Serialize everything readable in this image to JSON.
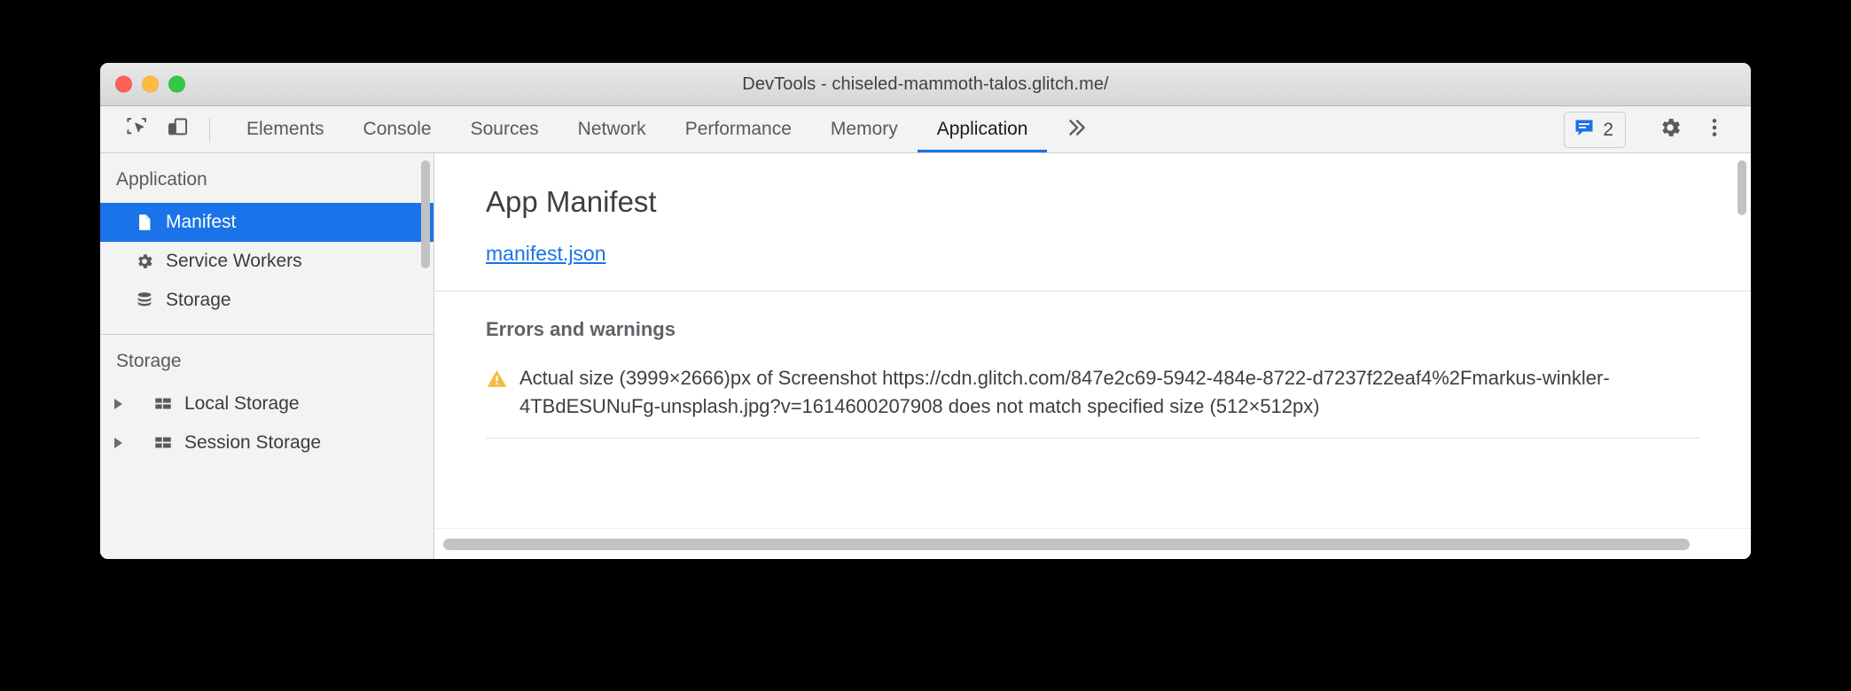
{
  "window": {
    "title": "DevTools - chiseled-mammoth-talos.glitch.me/",
    "traffic_lights": {
      "close_color": "#fc6058",
      "minimize_color": "#fdbc40",
      "maximize_color": "#34c749"
    }
  },
  "toolbar": {
    "inspect_icon": "inspect-element-icon",
    "device_icon": "device-toolbar-icon",
    "tabs": [
      {
        "label": "Elements",
        "selected": false
      },
      {
        "label": "Console",
        "selected": false
      },
      {
        "label": "Sources",
        "selected": false
      },
      {
        "label": "Network",
        "selected": false
      },
      {
        "label": "Performance",
        "selected": false
      },
      {
        "label": "Memory",
        "selected": false
      },
      {
        "label": "Application",
        "selected": true
      }
    ],
    "overflow_label": "»",
    "issues": {
      "icon": "console-message-icon",
      "count": "2",
      "icon_color": "#1a73e8"
    },
    "settings_icon": "gear-icon",
    "more_icon": "vertical-dots-icon",
    "accent_color": "#1a73e8"
  },
  "sidebar": {
    "sections": [
      {
        "title": "Application",
        "items": [
          {
            "label": "Manifest",
            "icon": "document-icon",
            "selected": true,
            "expandable": false
          },
          {
            "label": "Service Workers",
            "icon": "gear-icon",
            "selected": false,
            "expandable": false
          },
          {
            "label": "Storage",
            "icon": "database-icon",
            "selected": false,
            "expandable": false
          }
        ]
      },
      {
        "title": "Storage",
        "items": [
          {
            "label": "Local Storage",
            "icon": "table-icon",
            "selected": false,
            "expandable": true
          },
          {
            "label": "Session Storage",
            "icon": "table-icon",
            "selected": false,
            "expandable": true
          }
        ]
      }
    ],
    "selection_color": "#1a73e8"
  },
  "main": {
    "title": "App Manifest",
    "manifest_link": "manifest.json",
    "link_color": "#1a73e8",
    "errors": {
      "heading": "Errors and warnings",
      "items": [
        {
          "icon": "warning-triangle-icon",
          "icon_color": "#f5bb42",
          "text": "Actual size (3999×2666)px of Screenshot https://cdn.glitch.com/847e2c69-5942-484e-8722-d7237f22eaf4%2Fmarkus-winkler-4TBdESUNuFg-unsplash.jpg?v=1614600207908 does not match specified size (512×512px)"
        }
      ]
    }
  }
}
